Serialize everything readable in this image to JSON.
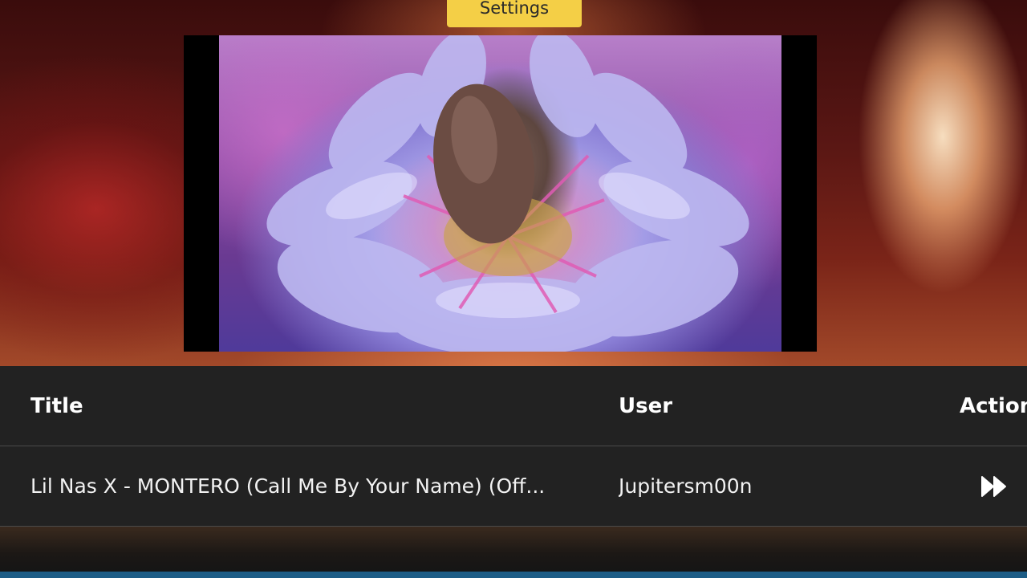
{
  "settings": {
    "label": "Settings"
  },
  "table": {
    "headers": {
      "title": "Title",
      "user": "User",
      "action": "Action"
    },
    "rows": [
      {
        "title": "Lil Nas X - MONTERO (Call Me By Your Name) (Off...",
        "user": "Jupitersm00n",
        "action_icon": "fast-forward-icon"
      }
    ]
  },
  "colors": {
    "settings_button": "#f4cf46",
    "table_background": "#222222",
    "bottom_bar": "#1d5d86"
  }
}
